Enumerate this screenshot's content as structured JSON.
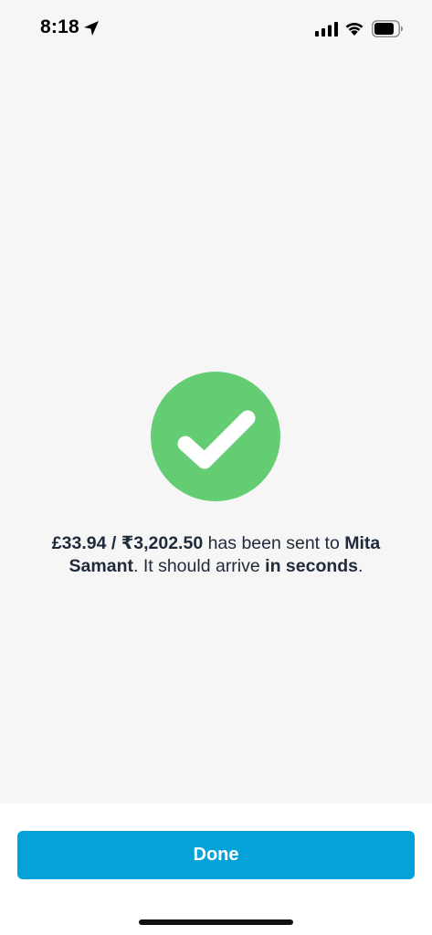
{
  "status_bar": {
    "time": "8:18",
    "icons": [
      "location-arrow-icon",
      "cellular-signal-icon",
      "wifi-icon",
      "battery-icon"
    ]
  },
  "success": {
    "icon": "checkmark-icon",
    "circle_color": "#64cd73",
    "message": {
      "amount": "£33.94 / ₹3,202.50",
      "text_1": " has been sent to ",
      "recipient_first": "Mita",
      "recipient_last": "Samant",
      "text_2": ". It should arrive ",
      "timing": "in seconds",
      "text_3": "."
    }
  },
  "actions": {
    "done_label": "Done",
    "button_color": "#03a2d8"
  }
}
